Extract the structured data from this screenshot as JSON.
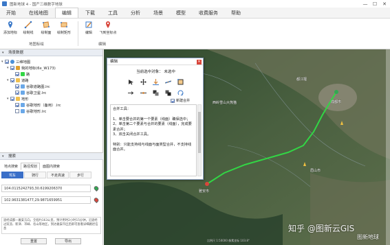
{
  "window": {
    "title": "图新地球 4 - 国产三维数字地球",
    "controls": [
      "—",
      "☐",
      "✕"
    ]
  },
  "menu": [
    "开始",
    "在线地图",
    "编辑",
    "下载",
    "工具",
    "分析",
    "场景",
    "模型",
    "收费服务",
    "帮助"
  ],
  "menu_active": 2,
  "ribbon": {
    "buttons": [
      {
        "label": "添加地标",
        "icon": "pin-icon"
      },
      {
        "label": "绘制线",
        "icon": "draw-line-icon"
      },
      {
        "label": "绘制面",
        "icon": "draw-polygon-icon"
      },
      {
        "label": "绘制矩形",
        "icon": "draw-rect-icon"
      },
      {
        "label": "编辑",
        "icon": "edit-icon"
      },
      {
        "label": "飞到坐标点",
        "icon": "fly-to-icon"
      }
    ],
    "groups": [
      "地图标绘",
      "编辑"
    ]
  },
  "scene": {
    "header": "场景数据",
    "items": [
      {
        "label": "三维地图",
        "checked": true,
        "icon": "globe"
      },
      {
        "label": "我的地标(6x_W173)",
        "checked": true,
        "icon": "pin"
      },
      {
        "label": "路",
        "checked": true,
        "icon": "line"
      },
      {
        "label": "道路",
        "checked": true,
        "icon": "folder"
      },
      {
        "label": "谷歌道路图.lrc",
        "checked": true,
        "icon": "layer"
      },
      {
        "label": "谷歌卫星.lrc",
        "checked": true,
        "icon": "layer"
      },
      {
        "label": "地形",
        "checked": true,
        "icon": "folder"
      },
      {
        "label": "谷歌地形（备用）.lrc",
        "checked": true,
        "icon": "layer"
      },
      {
        "label": "谷歌地形.lrc",
        "checked": false,
        "icon": "layer"
      }
    ]
  },
  "search": {
    "header": "搜索",
    "tabs": [
      "地点搜索",
      "路径规划",
      "面图内搜索"
    ],
    "modes": [
      "驾车",
      "骑行",
      "不走高速",
      "步行"
    ],
    "active_mode": 0,
    "start": "104.0115242793,30.6199206370",
    "end": "102.9631381477,29.9871659951",
    "result": "途经成都—雅安方向，全程约163公里，预计用时2小时15分钟，沿途经过双流、新津、邛崃、名山等地区，到达雅安市区后即可查看详细路径信息",
    "buttons": [
      "重置",
      "导出"
    ]
  },
  "dialog": {
    "title": "编辑",
    "selected_label": "当前选中对象：",
    "selected_value": "未选中",
    "merge_checkbox": "新建合并",
    "help_lines": [
      "合并工具：",
      "",
      "1、单击要合并的第一个要素（线面）确保选中；",
      "2、单击第二个要素与合并的要素（线面），完成要素合并；",
      "3、双击关闭合并工具。",
      "",
      "特别：只能支持线与线面与面类型合并，不支持线面合并。"
    ]
  },
  "map": {
    "labels": [
      "西岭雪山大熊猫",
      "成都市",
      "雅安市",
      "眉山市",
      "都江堰"
    ],
    "watermark": "知乎 @图新云GIS",
    "watermark2": "图新地球",
    "scale_text": "比例尺 1:50000 像素坐标 103.8°"
  },
  "colors": {
    "route": "#32d645",
    "accent": "#3a6fc8",
    "close": "#d9463b"
  }
}
